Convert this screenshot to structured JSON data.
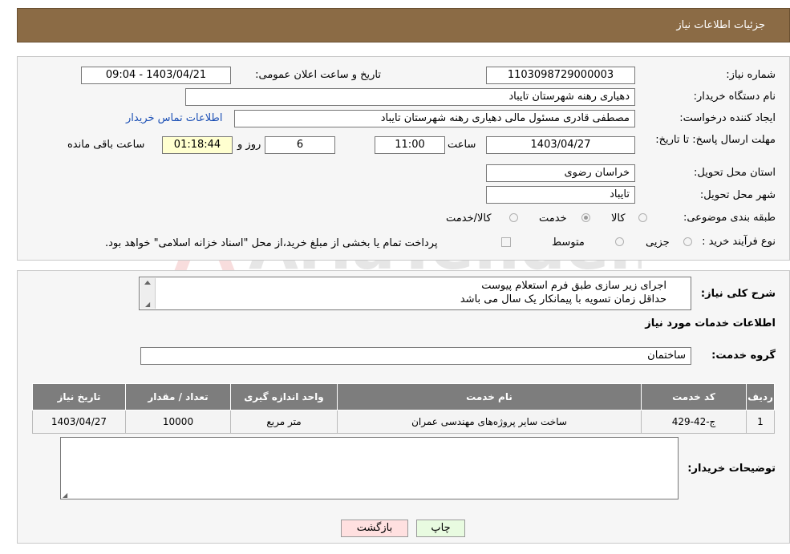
{
  "header": {
    "title": "جزئیات اطلاعات نیاز"
  },
  "form": {
    "need_number_label": "شماره نیاز:",
    "need_number": "1103098729000003",
    "announce_label": "تاریخ و ساعت اعلان عمومی:",
    "announce_value": "1403/04/21 - 09:04",
    "buyer_org_label": "نام دستگاه خریدار:",
    "buyer_org": "دهیاری رهنه  شهرستان تایباد",
    "creator_label": "ایجاد کننده درخواست:",
    "creator": "مصطفی قادری مسئول مالی دهیاری رهنه  شهرستان تایباد",
    "contact_link": "اطلاعات تماس خریدار",
    "deadline_label": "مهلت ارسال پاسخ: تا تاریخ:",
    "deadline_date": "1403/04/27",
    "time_label": "ساعت",
    "deadline_time": "11:00",
    "days_value": "6",
    "days_label": "روز و",
    "remaining_time": "01:18:44",
    "remaining_label": "ساعت باقی مانده",
    "province_label": "استان محل تحویل:",
    "province": "خراسان رضوی",
    "city_label": "شهر محل تحویل:",
    "city": "تایباد",
    "category_label": "طبقه بندی موضوعی:",
    "category_options": [
      "کالا",
      "خدمت",
      "کالا/خدمت"
    ],
    "category_selected": "خدمت",
    "process_label": "نوع فرآیند خرید :",
    "process_options": [
      "جزیی",
      "متوسط"
    ],
    "process_note": "پرداخت تمام یا بخشی از مبلغ خرید،از محل \"اسناد خزانه اسلامی\" خواهد بود."
  },
  "details": {
    "description_label": "شرح کلی نیاز:",
    "description_lines": [
      "اجرای زیر سازی طبق فرم استعلام پیوست",
      "حداقل زمان تسویه با پیمانکار یک سال می باشد"
    ],
    "services_title": "اطلاعات خدمات مورد نیاز",
    "service_group_label": "گروه خدمت:",
    "service_group": "ساختمان",
    "table": {
      "headers": [
        "ردیف",
        "کد خدمت",
        "نام خدمت",
        "واحد اندازه گیری",
        "تعداد / مقدار",
        "تاریخ نیاز"
      ],
      "rows": [
        [
          "1",
          "ج-42-429",
          "ساخت سایر پروژه‌های مهندسی عمران",
          "متر مربع",
          "10000",
          "1403/04/27"
        ]
      ]
    },
    "buyer_notes_label": "توضیحات خریدار:",
    "buyer_notes": ""
  },
  "buttons": {
    "print": "چاپ",
    "back": "بازگشت"
  },
  "watermark": "AriaTender.net"
}
